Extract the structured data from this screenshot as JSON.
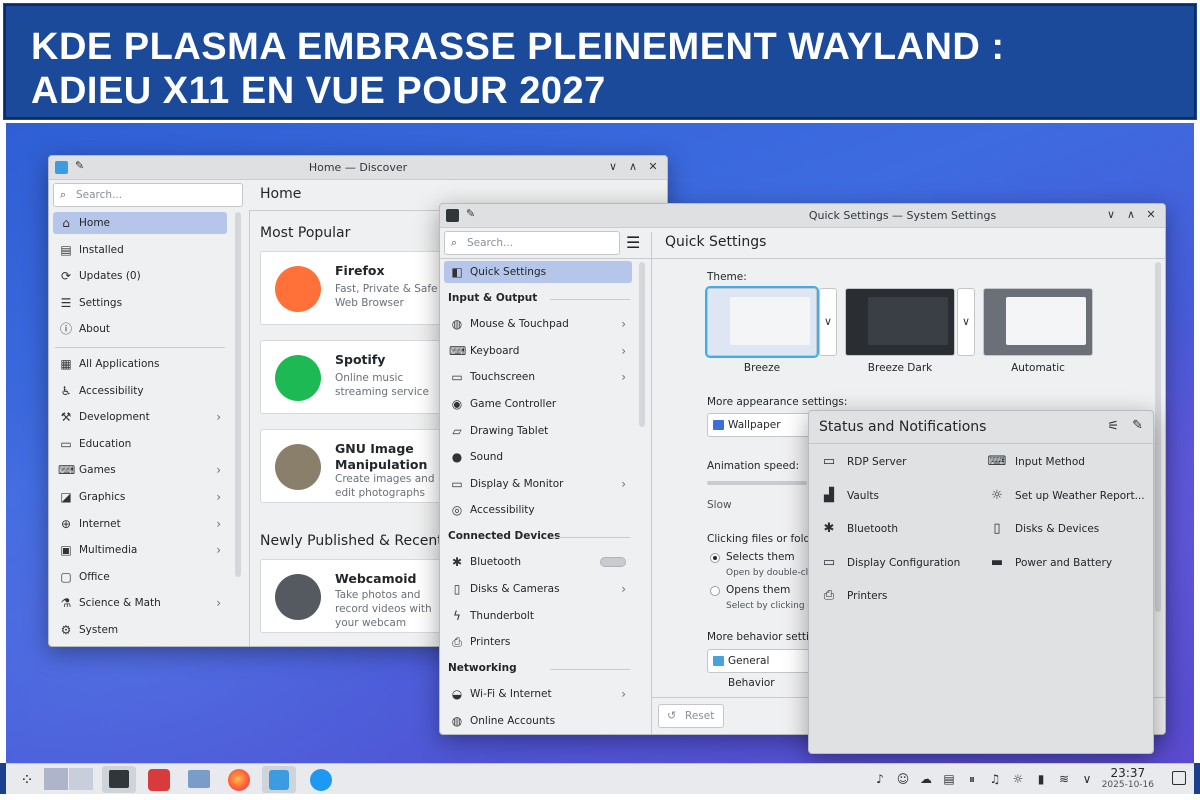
{
  "banner": {
    "title_line1": "KDE PLASMA EMBRASSE PLEINEMENT WAYLAND :",
    "title_line2": "ADIEU X11 EN VUE POUR 2027"
  },
  "discover": {
    "window_title": "Home — Discover",
    "search_placeholder": "Search...",
    "header": "Home",
    "nav": [
      {
        "label": "Home",
        "icon": "home-icon",
        "glyph": "⌂"
      },
      {
        "label": "Installed",
        "icon": "installed-icon",
        "glyph": "▤"
      },
      {
        "label": "Updates (0)",
        "icon": "updates-icon",
        "glyph": "⟳"
      },
      {
        "label": "Settings",
        "icon": "settings-icon",
        "glyph": "☰"
      },
      {
        "label": "About",
        "icon": "about-icon",
        "glyph": "ⓘ"
      }
    ],
    "categories": [
      {
        "label": "All Applications",
        "glyph": "▦",
        "chev": false
      },
      {
        "label": "Accessibility",
        "glyph": "♿",
        "chev": false
      },
      {
        "label": "Development",
        "glyph": "⚒",
        "chev": true
      },
      {
        "label": "Education",
        "glyph": "▭",
        "chev": false
      },
      {
        "label": "Games",
        "glyph": "⌨",
        "chev": true
      },
      {
        "label": "Graphics",
        "glyph": "◪",
        "chev": true
      },
      {
        "label": "Internet",
        "glyph": "⊕",
        "chev": true
      },
      {
        "label": "Multimedia",
        "glyph": "▣",
        "chev": true
      },
      {
        "label": "Office",
        "glyph": "▢",
        "chev": false
      },
      {
        "label": "Science & Math",
        "glyph": "⚗",
        "chev": true
      },
      {
        "label": "System",
        "glyph": "⚙",
        "chev": false
      }
    ],
    "most_popular_label": "Most Popular",
    "popular_apps": [
      {
        "name": "Firefox",
        "desc": "Fast, Private & Safe Web Browser",
        "color": "#ff7139"
      },
      {
        "name": "Spotify",
        "desc": "Online music streaming service",
        "color": "#1db954"
      },
      {
        "name": "GNU Image Manipulation",
        "desc": "Create images and edit photographs",
        "color": "#8a7f6a"
      }
    ],
    "newly_label": "Newly Published & Recently",
    "new_apps": [
      {
        "name": "Webcamoid",
        "desc": "Take photos and record videos with your webcam",
        "color": "#555a60"
      }
    ]
  },
  "settings": {
    "window_title": "Quick Settings — System Settings",
    "search_placeholder": "Search...",
    "header": "Quick Settings",
    "sidebar": [
      {
        "type": "item",
        "label": "Quick Settings",
        "glyph": "◧",
        "active": true,
        "chev": false
      },
      {
        "type": "section",
        "label": "Input & Output"
      },
      {
        "type": "item",
        "label": "Mouse & Touchpad",
        "glyph": "◍",
        "chev": true
      },
      {
        "type": "item",
        "label": "Keyboard",
        "glyph": "⌨",
        "chev": true
      },
      {
        "type": "item",
        "label": "Touchscreen",
        "glyph": "▭",
        "chev": true
      },
      {
        "type": "item",
        "label": "Game Controller",
        "glyph": "◉",
        "chev": false
      },
      {
        "type": "item",
        "label": "Drawing Tablet",
        "glyph": "▱",
        "chev": false
      },
      {
        "type": "item",
        "label": "Sound",
        "glyph": "●",
        "chev": false
      },
      {
        "type": "item",
        "label": "Display & Monitor",
        "glyph": "▭",
        "chev": true
      },
      {
        "type": "item",
        "label": "Accessibility",
        "glyph": "◎",
        "chev": false
      },
      {
        "type": "section",
        "label": "Connected Devices"
      },
      {
        "type": "item",
        "label": "Bluetooth",
        "glyph": "✱",
        "chev": false,
        "toggle": true
      },
      {
        "type": "item",
        "label": "Disks & Cameras",
        "glyph": "▯",
        "chev": true
      },
      {
        "type": "item",
        "label": "Thunderbolt",
        "glyph": "ϟ",
        "chev": false
      },
      {
        "type": "item",
        "label": "Printers",
        "glyph": "⎙",
        "chev": false
      },
      {
        "type": "section",
        "label": "Networking"
      },
      {
        "type": "item",
        "label": "Wi-Fi & Internet",
        "glyph": "◒",
        "chev": true
      },
      {
        "type": "item",
        "label": "Online Accounts",
        "glyph": "◍",
        "chev": false
      }
    ],
    "theme_label": "Theme:",
    "themes": [
      {
        "label": "Breeze",
        "bg": "#dfe6f3"
      },
      {
        "label": "Breeze Dark",
        "bg": "#2a2e33"
      },
      {
        "label": "Automatic",
        "bg": "#6a6f78"
      }
    ],
    "more_appearance_label": "More appearance settings:",
    "wallpaper_button": "Wallpaper",
    "animation_speed_label": "Animation speed:",
    "slow_label": "Slow",
    "clicking_label": "Clicking files or folder",
    "radio_selects": "Selects them",
    "radio_selects_sub": "Open by double-click",
    "radio_opens": "Opens them",
    "radio_opens_sub": "Select by clicking on",
    "more_behavior_label": "More behavior setting",
    "general_behavior_button": "General Behavior",
    "reset_button": "Reset"
  },
  "status_popup": {
    "title": "Status and Notifications",
    "items_left": [
      {
        "label": "RDP Server",
        "glyph": "▭"
      },
      {
        "label": "Vaults",
        "glyph": "▟"
      },
      {
        "label": "Bluetooth",
        "glyph": "✱"
      },
      {
        "label": "Display Configuration",
        "glyph": "▭"
      },
      {
        "label": "Printers",
        "glyph": "⎙"
      }
    ],
    "items_right": [
      {
        "label": "Input Method",
        "glyph": "⌨"
      },
      {
        "label": "Set up Weather Report...",
        "glyph": "☼"
      },
      {
        "label": "Disks & Devices",
        "glyph": "▯"
      },
      {
        "label": "Power and Battery",
        "glyph": "▬"
      }
    ]
  },
  "taskbar": {
    "time": "23:37",
    "date": "2025-10-16",
    "tray_icons": [
      "notifications-icon",
      "user-icon",
      "cloud-sync-icon",
      "clipboard-icon",
      "media-pause-icon",
      "volume-icon",
      "brightness-icon",
      "battery-icon",
      "wifi-icon",
      "expand-tray-icon"
    ]
  }
}
